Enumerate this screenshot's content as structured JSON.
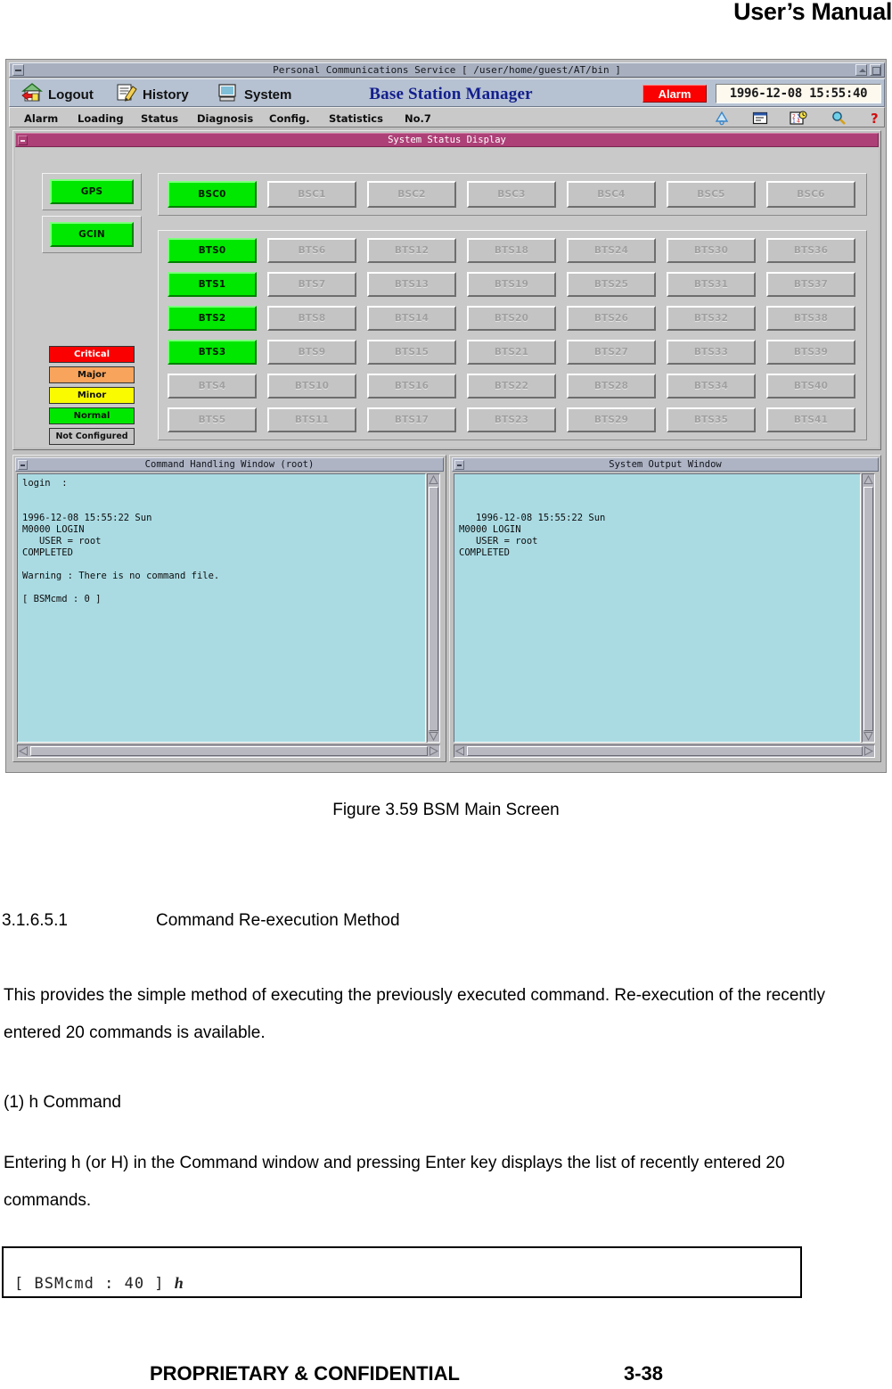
{
  "document": {
    "header_title": "User’s Manual",
    "figure_caption": "Figure 3.59 BSM Main Screen",
    "section_number": "3.1.6.5.1",
    "section_title": "Command Re-execution Method",
    "paragraph_1": " This provides the simple method of executing the previously executed command. Re-execution of the recently entered 20 commands is available.",
    "paragraph_2": "(1)  h  Command",
    "paragraph_3": "Entering h (or H) in the Command window and pressing Enter key displays the list of recently entered 20 commands.",
    "command_box_prompt": "[ BSMcmd : 40 ]",
    "command_box_input": "h",
    "footer_left": "PROPRIETARY & CONFIDENTIAL",
    "footer_right": "3-38"
  },
  "window": {
    "title": "Personal Communications Service [ /user/home/guest/AT/bin ]",
    "brand_title": "Base Station Manager",
    "alarm_button": "Alarm",
    "clock": "1996-12-08 15:55:40",
    "brand_items": [
      {
        "label": "Logout",
        "icon": "house-with-arrow-icon"
      },
      {
        "label": "History",
        "icon": "notepad-pencil-icon"
      },
      {
        "label": "System",
        "icon": "monitor-icon"
      }
    ],
    "menu_items": [
      "Alarm",
      "Loading",
      "Status",
      "Diagnosis",
      "Config.",
      "Statistics",
      "No.7"
    ],
    "tool_icons": [
      "bell-icon",
      "message-window-icon",
      "calendar-clock-icon",
      "magnifier-icon",
      "help-question-icon"
    ]
  },
  "status_display": {
    "title": "System Status Display",
    "system_buttons": [
      {
        "label": "GPS",
        "state": "normal"
      },
      {
        "label": "GCIN",
        "state": "normal"
      }
    ],
    "legend": [
      {
        "label": "Critical",
        "color": "#fb0000",
        "text_color": "#ffffff"
      },
      {
        "label": "Major",
        "color": "#f9a45c",
        "text_color": "#111111"
      },
      {
        "label": "Minor",
        "color": "#fbfb00",
        "text_color": "#111111"
      },
      {
        "label": "Normal",
        "color": "#00e800",
        "text_color": "#111111"
      },
      {
        "label": "Not Configured",
        "color": "#c4c4c4",
        "text_color": "#111111"
      }
    ],
    "bsc_buttons": [
      {
        "label": "BSC0",
        "state": "normal"
      },
      {
        "label": "BSC1",
        "state": "not-configured"
      },
      {
        "label": "BSC2",
        "state": "not-configured"
      },
      {
        "label": "BSC3",
        "state": "not-configured"
      },
      {
        "label": "BSC4",
        "state": "not-configured"
      },
      {
        "label": "BSC5",
        "state": "not-configured"
      },
      {
        "label": "BSC6",
        "state": "not-configured"
      }
    ],
    "bts_columns": [
      [
        {
          "label": "BTS0",
          "state": "normal"
        },
        {
          "label": "BTS1",
          "state": "normal"
        },
        {
          "label": "BTS2",
          "state": "normal"
        },
        {
          "label": "BTS3",
          "state": "normal"
        },
        {
          "label": "BTS4",
          "state": "not-configured"
        },
        {
          "label": "BTS5",
          "state": "not-configured"
        }
      ],
      [
        {
          "label": "BTS6",
          "state": "not-configured"
        },
        {
          "label": "BTS7",
          "state": "not-configured"
        },
        {
          "label": "BTS8",
          "state": "not-configured"
        },
        {
          "label": "BTS9",
          "state": "not-configured"
        },
        {
          "label": "BTS10",
          "state": "not-configured"
        },
        {
          "label": "BTS11",
          "state": "not-configured"
        }
      ],
      [
        {
          "label": "BTS12",
          "state": "not-configured"
        },
        {
          "label": "BTS13",
          "state": "not-configured"
        },
        {
          "label": "BTS14",
          "state": "not-configured"
        },
        {
          "label": "BTS15",
          "state": "not-configured"
        },
        {
          "label": "BTS16",
          "state": "not-configured"
        },
        {
          "label": "BTS17",
          "state": "not-configured"
        }
      ],
      [
        {
          "label": "BTS18",
          "state": "not-configured"
        },
        {
          "label": "BTS19",
          "state": "not-configured"
        },
        {
          "label": "BTS20",
          "state": "not-configured"
        },
        {
          "label": "BTS21",
          "state": "not-configured"
        },
        {
          "label": "BTS22",
          "state": "not-configured"
        },
        {
          "label": "BTS23",
          "state": "not-configured"
        }
      ],
      [
        {
          "label": "BTS24",
          "state": "not-configured"
        },
        {
          "label": "BTS25",
          "state": "not-configured"
        },
        {
          "label": "BTS26",
          "state": "not-configured"
        },
        {
          "label": "BTS27",
          "state": "not-configured"
        },
        {
          "label": "BTS28",
          "state": "not-configured"
        },
        {
          "label": "BTS29",
          "state": "not-configured"
        }
      ],
      [
        {
          "label": "BTS30",
          "state": "not-configured"
        },
        {
          "label": "BTS31",
          "state": "not-configured"
        },
        {
          "label": "BTS32",
          "state": "not-configured"
        },
        {
          "label": "BTS33",
          "state": "not-configured"
        },
        {
          "label": "BTS34",
          "state": "not-configured"
        },
        {
          "label": "BTS35",
          "state": "not-configured"
        }
      ],
      [
        {
          "label": "BTS36",
          "state": "not-configured"
        },
        {
          "label": "BTS37",
          "state": "not-configured"
        },
        {
          "label": "BTS38",
          "state": "not-configured"
        },
        {
          "label": "BTS39",
          "state": "not-configured"
        },
        {
          "label": "BTS40",
          "state": "not-configured"
        },
        {
          "label": "BTS41",
          "state": "not-configured"
        }
      ]
    ]
  },
  "command_window": {
    "title": "Command Handling Window (root)",
    "content": "login  :\n\n\n1996-12-08 15:55:22 Sun\nM0000 LOGIN\n   USER = root\nCOMPLETED\n\nWarning : There is no command file.\n\n[ BSMcmd : 0 ]"
  },
  "output_window": {
    "title": "System Output Window",
    "content": "\n\n\n   1996-12-08 15:55:22 Sun\nM0000 LOGIN\n   USER = root\nCOMPLETED"
  },
  "colors": {
    "normal_green": "#00e800",
    "critical_red": "#fb0000",
    "major_orange": "#f9a45c",
    "minor_yellow": "#fbfb00",
    "not_configured_grey": "#c4c4c4",
    "title_magenta": "#ad4077",
    "brand_blue": "#131f8c",
    "terminal_cyan": "#aadbe3"
  }
}
